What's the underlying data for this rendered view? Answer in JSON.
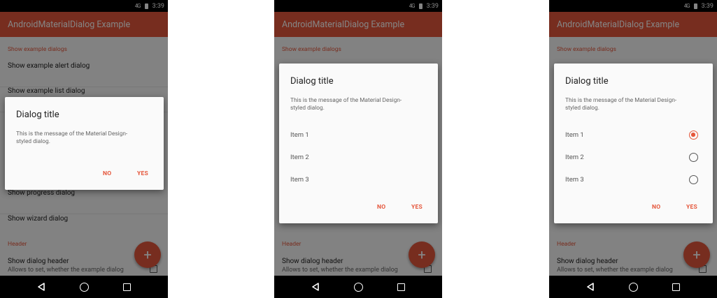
{
  "status_bar": {
    "signal": "4G",
    "time": "3:39"
  },
  "app_bar": {
    "title": "AndroidMaterialDialog Example"
  },
  "list": {
    "section_examples": "Show example dialogs",
    "alert_dialog": "Show example alert dialog",
    "list_dialog": "Show example list dialog",
    "progress_dialog": "Show progress dialog",
    "wizard_dialog": "Show wizard dialog",
    "section_header": "Header",
    "dialog_header": "Show dialog header",
    "dialog_header_sub": "Allows to set, whether the example dialog"
  },
  "fab": {
    "icon": "plus-icon",
    "glyph": "+"
  },
  "dialog": {
    "title": "Dialog title",
    "message_line1": "This is the message of the Material Design-",
    "message_line2": "styled dialog.",
    "items": [
      "Item 1",
      "Item 2",
      "Item 3"
    ],
    "selected_index": 0,
    "negative_button": "NO",
    "positive_button": "YES"
  },
  "colors": {
    "accent": "#e5573c",
    "scrim": "rgba(0,0,0,0.48)"
  }
}
